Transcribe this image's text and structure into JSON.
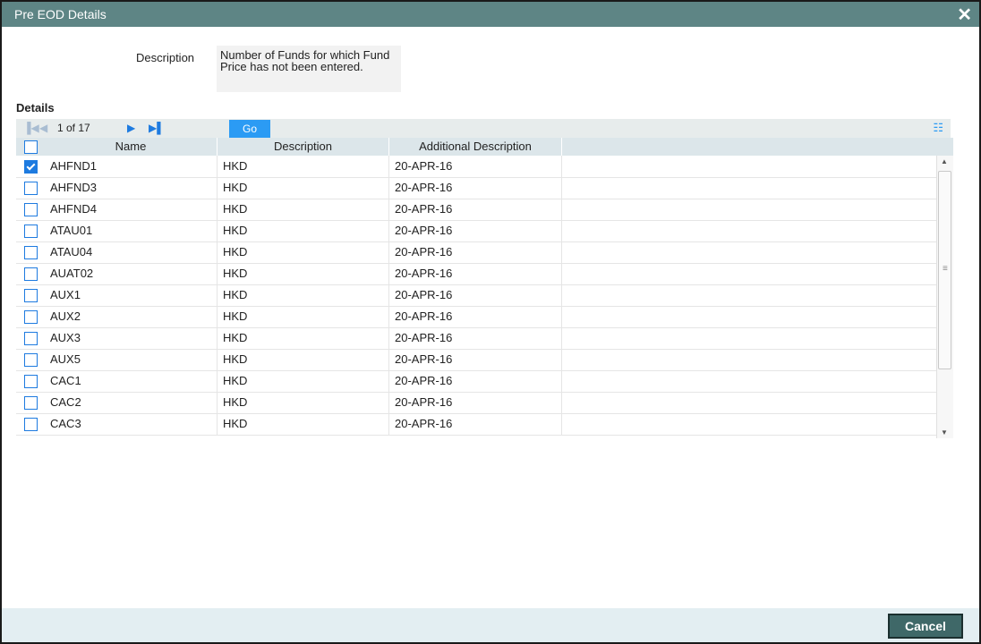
{
  "window": {
    "title": "Pre EOD Details",
    "close_glyph": "✕"
  },
  "form": {
    "description_label": "Description",
    "description_value": "Number of Funds for which Fund Price has not been entered."
  },
  "details": {
    "label": "Details",
    "pager": {
      "page_info": "1 of 17",
      "go_label": "Go"
    },
    "columns": [
      "Name",
      "Description",
      "Additional Description"
    ],
    "rows": [
      {
        "name": "AHFND1",
        "description": "HKD",
        "additional": "20-APR-16",
        "checked": true
      },
      {
        "name": "AHFND3",
        "description": "HKD",
        "additional": "20-APR-16",
        "checked": false
      },
      {
        "name": "AHFND4",
        "description": "HKD",
        "additional": "20-APR-16",
        "checked": false
      },
      {
        "name": "ATAU01",
        "description": "HKD",
        "additional": "20-APR-16",
        "checked": false
      },
      {
        "name": "ATAU04",
        "description": "HKD",
        "additional": "20-APR-16",
        "checked": false
      },
      {
        "name": "AUAT02",
        "description": "HKD",
        "additional": "20-APR-16",
        "checked": false
      },
      {
        "name": "AUX1",
        "description": "HKD",
        "additional": "20-APR-16",
        "checked": false
      },
      {
        "name": "AUX2",
        "description": "HKD",
        "additional": "20-APR-16",
        "checked": false
      },
      {
        "name": "AUX3",
        "description": "HKD",
        "additional": "20-APR-16",
        "checked": false
      },
      {
        "name": "AUX5",
        "description": "HKD",
        "additional": "20-APR-16",
        "checked": false
      },
      {
        "name": "CAC1",
        "description": "HKD",
        "additional": "20-APR-16",
        "checked": false
      },
      {
        "name": "CAC2",
        "description": "HKD",
        "additional": "20-APR-16",
        "checked": false
      },
      {
        "name": "CAC3",
        "description": "HKD",
        "additional": "20-APR-16",
        "checked": false
      }
    ]
  },
  "footer": {
    "cancel_label": "Cancel"
  },
  "icons": {
    "first_page": "first-page-icon",
    "prev_page": "prev-page-icon",
    "next_page": "next-page-icon",
    "last_page": "last-page-icon",
    "settings": "column-settings-icon",
    "close": "close-icon"
  },
  "colors": {
    "titlebar": "#5e8585",
    "accent": "#2b9bf4",
    "header_bg": "#dce6ea",
    "footer_bg": "#e3eef2",
    "cancel_bg": "#3f6868"
  }
}
